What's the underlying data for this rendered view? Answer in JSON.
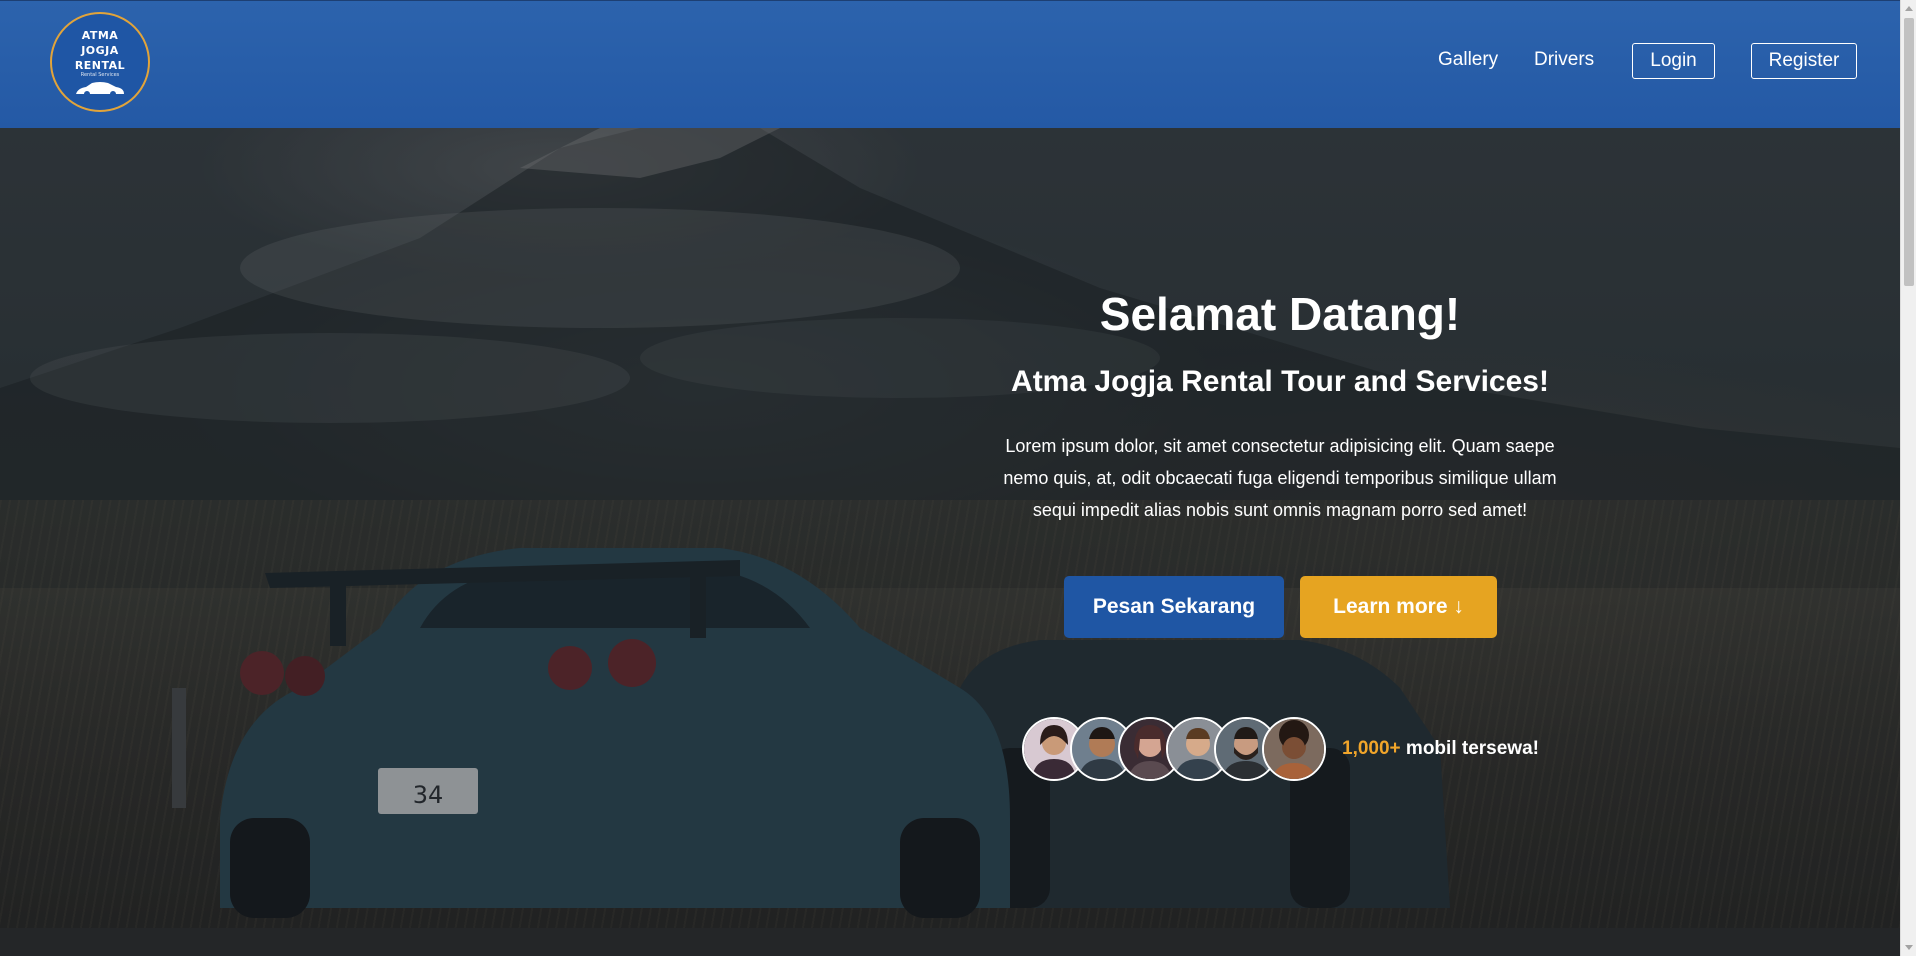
{
  "brand": {
    "logo_lines": [
      "ATMA",
      "JOGJA",
      "RENTAL"
    ],
    "logo_sub": "Rental Services",
    "logo_border_color": "#e2a43a",
    "navbar_color": "#2a60aa"
  },
  "nav": {
    "gallery": "Gallery",
    "drivers": "Drivers",
    "login": "Login",
    "register": "Register"
  },
  "hero": {
    "title": "Selamat Datang!",
    "subtitle": "Atma Jogja Rental Tour and Services!",
    "description": "Lorem ipsum dolor, sit amet consectetur adipisicing elit. Quam saepe nemo quis, at, odit obcaecati fuga eligendi temporibus similique ullam sequi impedit alias nobis sunt omnis magnam porro sed amet!",
    "primary_button": "Pesan Sekarang",
    "secondary_button": "Learn more ↓",
    "primary_color": "#1f56a4",
    "secondary_color": "#e6a421",
    "stat_number": "1,000+",
    "stat_label": " mobil tersewa!",
    "stat_color": "#f1a52a",
    "avatars": [
      "customer-avatar",
      "customer-avatar",
      "customer-avatar",
      "customer-avatar",
      "customer-avatar",
      "customer-avatar"
    ]
  }
}
